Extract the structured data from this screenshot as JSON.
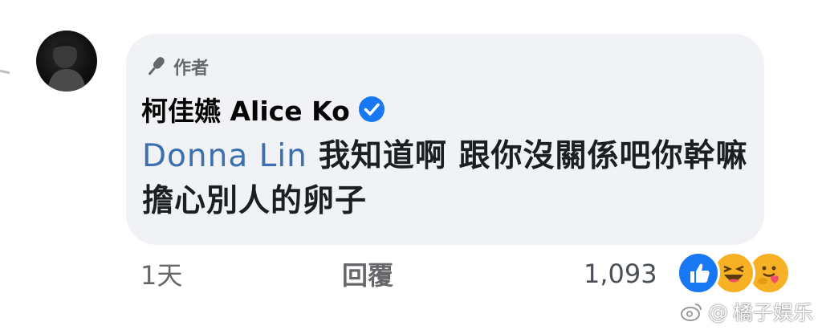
{
  "comment": {
    "author_badge": "作者",
    "author_name": "柯佳嬿 Alice Ko",
    "mention": "Donna Lin",
    "text": "我知道啊 跟你沒關係吧你幹嘛擔心別人的卵子"
  },
  "actions": {
    "time": "1天",
    "reply": "回覆"
  },
  "reactions": {
    "count": "1,093",
    "types": [
      "like",
      "haha",
      "care"
    ]
  },
  "watermark": {
    "text": "橘子娱乐",
    "symbol": "@"
  },
  "colors": {
    "bubble": "#f0f2f5",
    "mention": "#3b6fb0",
    "verified": "#1877f2",
    "like": "#1877f2",
    "haha": "#f7b125"
  },
  "icons": {
    "badge": "microphone-icon",
    "verified": "verified-check-icon",
    "watermark": "weibo-icon"
  }
}
